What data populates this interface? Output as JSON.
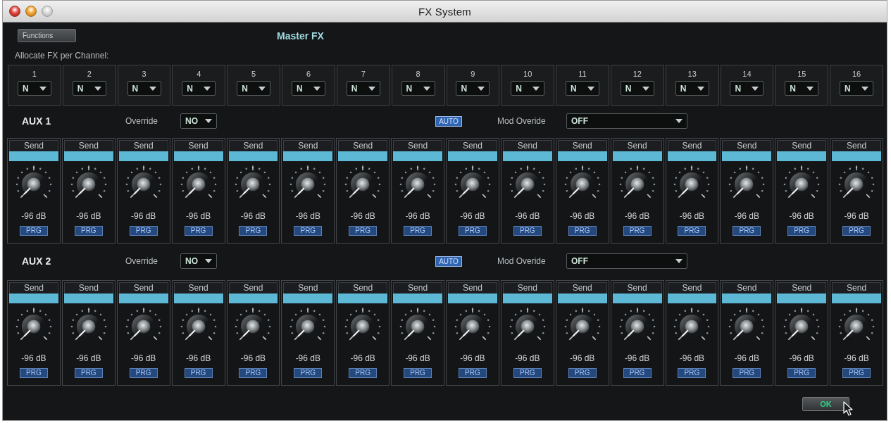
{
  "window": {
    "title": "FX System"
  },
  "functions_button": {
    "label": "Functions"
  },
  "heading": "Master FX",
  "allocate": {
    "label": "Allocate FX per Channel:",
    "channels": [
      {
        "number": "1",
        "value": "N"
      },
      {
        "number": "2",
        "value": "N"
      },
      {
        "number": "3",
        "value": "N"
      },
      {
        "number": "4",
        "value": "N"
      },
      {
        "number": "5",
        "value": "N"
      },
      {
        "number": "6",
        "value": "N"
      },
      {
        "number": "7",
        "value": "N"
      },
      {
        "number": "8",
        "value": "N"
      },
      {
        "number": "9",
        "value": "N"
      },
      {
        "number": "10",
        "value": "N"
      },
      {
        "number": "11",
        "value": "N"
      },
      {
        "number": "12",
        "value": "N"
      },
      {
        "number": "13",
        "value": "N"
      },
      {
        "number": "14",
        "value": "N"
      },
      {
        "number": "15",
        "value": "N"
      },
      {
        "number": "16",
        "value": "N"
      }
    ]
  },
  "aux_sections": [
    {
      "name": "AUX 1",
      "override_label": "Override",
      "override_value": "NO",
      "auto_button": "AUTO",
      "mod_override_label": "Mod Overide",
      "mod_override_value": "OFF",
      "sends": [
        {
          "label": "Send",
          "reading": "-96 dB",
          "button": "PRG"
        },
        {
          "label": "Send",
          "reading": "-96 dB",
          "button": "PRG"
        },
        {
          "label": "Send",
          "reading": "-96 dB",
          "button": "PRG"
        },
        {
          "label": "Send",
          "reading": "-96 dB",
          "button": "PRG"
        },
        {
          "label": "Send",
          "reading": "-96 dB",
          "button": "PRG"
        },
        {
          "label": "Send",
          "reading": "-96 dB",
          "button": "PRG"
        },
        {
          "label": "Send",
          "reading": "-96 dB",
          "button": "PRG"
        },
        {
          "label": "Send",
          "reading": "-96 dB",
          "button": "PRG"
        },
        {
          "label": "Send",
          "reading": "-96 dB",
          "button": "PRG"
        },
        {
          "label": "Send",
          "reading": "-96 dB",
          "button": "PRG"
        },
        {
          "label": "Send",
          "reading": "-96 dB",
          "button": "PRG"
        },
        {
          "label": "Send",
          "reading": "-96 dB",
          "button": "PRG"
        },
        {
          "label": "Send",
          "reading": "-96 dB",
          "button": "PRG"
        },
        {
          "label": "Send",
          "reading": "-96 dB",
          "button": "PRG"
        },
        {
          "label": "Send",
          "reading": "-96 dB",
          "button": "PRG"
        },
        {
          "label": "Send",
          "reading": "-96 dB",
          "button": "PRG"
        }
      ]
    },
    {
      "name": "AUX 2",
      "override_label": "Override",
      "override_value": "NO",
      "auto_button": "AUTO",
      "mod_override_label": "Mod Overide",
      "mod_override_value": "OFF",
      "sends": [
        {
          "label": "Send",
          "reading": "-96 dB",
          "button": "PRG"
        },
        {
          "label": "Send",
          "reading": "-96 dB",
          "button": "PRG"
        },
        {
          "label": "Send",
          "reading": "-96 dB",
          "button": "PRG"
        },
        {
          "label": "Send",
          "reading": "-96 dB",
          "button": "PRG"
        },
        {
          "label": "Send",
          "reading": "-96 dB",
          "button": "PRG"
        },
        {
          "label": "Send",
          "reading": "-96 dB",
          "button": "PRG"
        },
        {
          "label": "Send",
          "reading": "-96 dB",
          "button": "PRG"
        },
        {
          "label": "Send",
          "reading": "-96 dB",
          "button": "PRG"
        },
        {
          "label": "Send",
          "reading": "-96 dB",
          "button": "PRG"
        },
        {
          "label": "Send",
          "reading": "-96 dB",
          "button": "PRG"
        },
        {
          "label": "Send",
          "reading": "-96 dB",
          "button": "PRG"
        },
        {
          "label": "Send",
          "reading": "-96 dB",
          "button": "PRG"
        },
        {
          "label": "Send",
          "reading": "-96 dB",
          "button": "PRG"
        },
        {
          "label": "Send",
          "reading": "-96 dB",
          "button": "PRG"
        },
        {
          "label": "Send",
          "reading": "-96 dB",
          "button": "PRG"
        },
        {
          "label": "Send",
          "reading": "-96 dB",
          "button": "PRG"
        }
      ]
    }
  ],
  "ok_button": {
    "label": "OK"
  }
}
